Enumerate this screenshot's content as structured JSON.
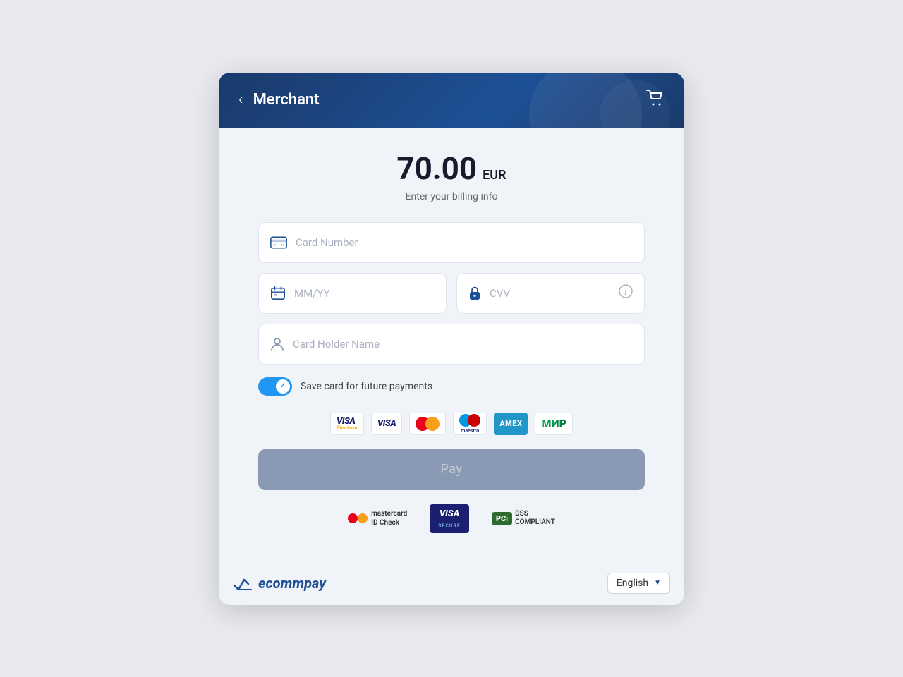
{
  "header": {
    "title": "Merchant",
    "back_label": "‹",
    "cart_icon": "🛒"
  },
  "amount": {
    "value": "70.00",
    "currency": "EUR",
    "subtitle": "Enter your billing info"
  },
  "form": {
    "card_number_placeholder": "Card Number",
    "expiry_placeholder": "MM/YY",
    "cvv_placeholder": "CVV",
    "card_holder_placeholder": "Card Holder Name",
    "save_card_label": "Save card for future payments"
  },
  "pay_button": {
    "label": "Pay"
  },
  "language": {
    "current": "English"
  },
  "footer": {
    "brand": "ecommpay"
  },
  "security": {
    "mastercard_label": "mastercard\nID Check",
    "visa_label": "VISA",
    "visa_sublabel": "SECURE",
    "pci_label": "PCI",
    "dss_label": "DSS\nCOMPLIANT"
  }
}
